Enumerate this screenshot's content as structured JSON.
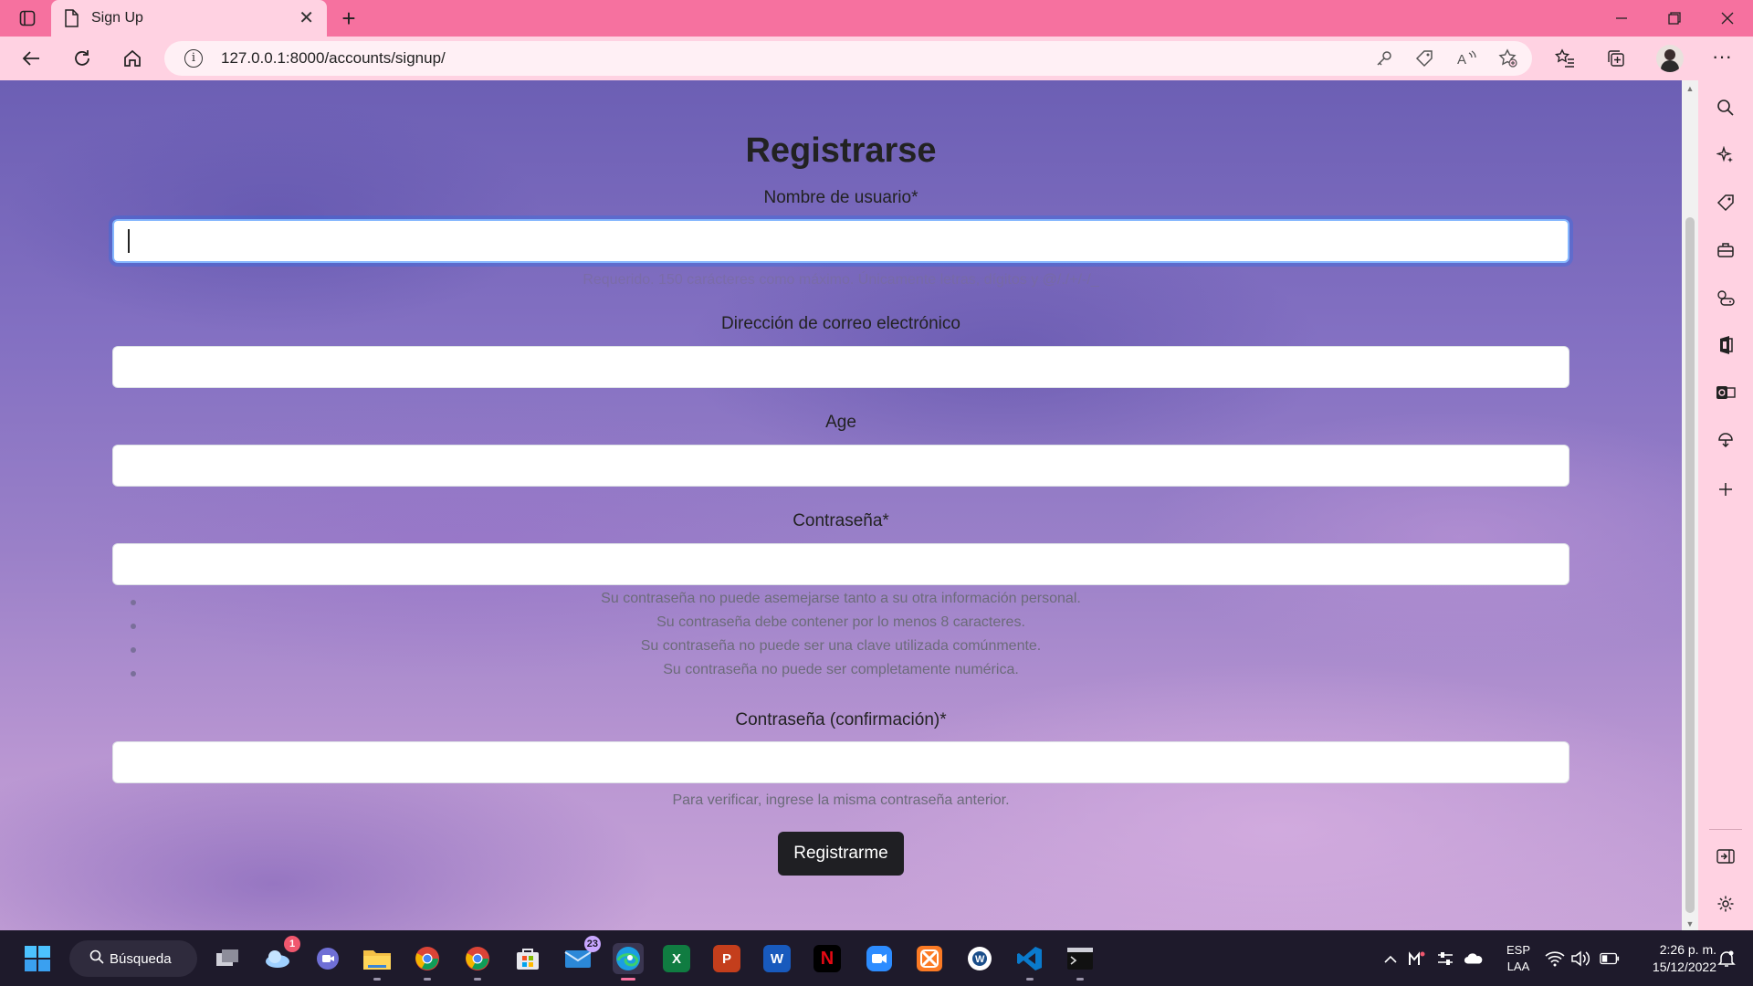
{
  "browser": {
    "tab_title": "Sign Up",
    "url": "127.0.0.1:8000/accounts/signup/"
  },
  "form": {
    "title": "Registrarse",
    "username_label": "Nombre de usuario*",
    "username_help": "Requerido. 150 carácteres como máximo. Únicamente letras, dígitos y @/./+/-/_",
    "email_label": "Dirección de correo electrónico",
    "age_label": "Age",
    "password_label": "Contraseña*",
    "password_rules": [
      "Su contraseña no puede asemejarse tanto a su otra información personal.",
      "Su contraseña debe contener por lo menos 8 caracteres.",
      "Su contraseña no puede ser una clave utilizada comúnmente.",
      "Su contraseña no puede ser completamente numérica."
    ],
    "password_confirm_label": "Contraseña (confirmación)*",
    "password_confirm_help": "Para verificar, ingrese la misma contraseña anterior.",
    "submit_label": "Registrarme"
  },
  "taskbar": {
    "search_label": "Búsqueda",
    "weather_badge": "1",
    "mail_badge": "23",
    "language": "ESP",
    "layout": "LAA",
    "time": "2:26 p. m.",
    "date": "15/12/2022"
  }
}
